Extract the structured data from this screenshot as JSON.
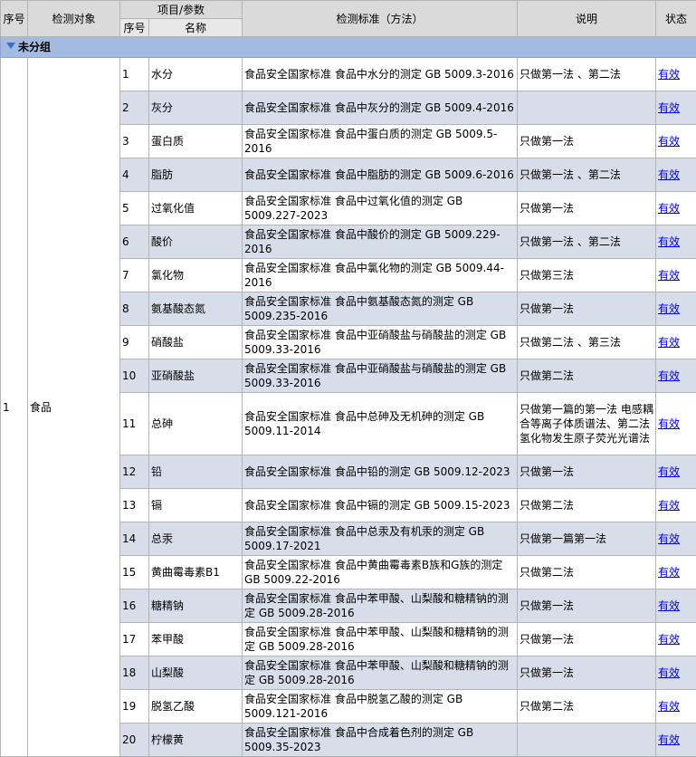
{
  "headers": {
    "seq": "序号",
    "object": "检测对象",
    "item_group": "项目/参数",
    "item_seq": "序号",
    "item_name": "名称",
    "standard": "检测标准（方法）",
    "note": "说明",
    "status": "状态"
  },
  "group": {
    "label": "未分组"
  },
  "object_row": {
    "seq": "1",
    "name": "食品"
  },
  "items": [
    {
      "no": "1",
      "name": "水分",
      "standard": "食品安全国家标准 食品中水分的测定 GB 5009.3-2016",
      "note": "只做第一法 、第二法",
      "status": "有效"
    },
    {
      "no": "2",
      "name": "灰分",
      "standard": "食品安全国家标准 食品中灰分的测定 GB 5009.4-2016",
      "note": "",
      "status": "有效"
    },
    {
      "no": "3",
      "name": "蛋白质",
      "standard": "食品安全国家标准 食品中蛋白质的测定 GB 5009.5-2016",
      "note": "只做第一法",
      "status": "有效"
    },
    {
      "no": "4",
      "name": "脂肪",
      "standard": "食品安全国家标准 食品中脂肪的测定 GB 5009.6-2016",
      "note": "只做第一法 、第二法",
      "status": "有效"
    },
    {
      "no": "5",
      "name": "过氧化值",
      "standard": "食品安全国家标准 食品中过氧化值的测定 GB 5009.227-2023",
      "note": "只做第一法",
      "status": "有效"
    },
    {
      "no": "6",
      "name": "酸价",
      "standard": "食品安全国家标准 食品中酸价的测定 GB 5009.229-2016",
      "note": "只做第一法 、第二法",
      "status": "有效"
    },
    {
      "no": "7",
      "name": "氯化物",
      "standard": "食品安全国家标准 食品中氯化物的测定 GB 5009.44-2016",
      "note": "只做第三法",
      "status": "有效"
    },
    {
      "no": "8",
      "name": "氨基酸态氮",
      "standard": "食品安全国家标准 食品中氨基酸态氮的测定 GB 5009.235-2016",
      "note": "只做第一法",
      "status": "有效"
    },
    {
      "no": "9",
      "name": "硝酸盐",
      "standard": "食品安全国家标准 食品中亚硝酸盐与硝酸盐的测定 GB 5009.33-2016",
      "note": "只做第二法 、第三法",
      "status": "有效"
    },
    {
      "no": "10",
      "name": "亚硝酸盐",
      "standard": "食品安全国家标准 食品中亚硝酸盐与硝酸盐的测定 GB 5009.33-2016",
      "note": "只做第二法",
      "status": "有效"
    },
    {
      "no": "11",
      "name": "总砷",
      "standard": "食品安全国家标准 食品中总砷及无机砷的测定 GB 5009.11-2014",
      "note": "只做第一篇的第一法 电感耦合等离子体质谱法、第二法 氢化物发生原子荧光光谱法",
      "status": "有效",
      "tall": true
    },
    {
      "no": "12",
      "name": "铅",
      "standard": "食品安全国家标准 食品中铅的测定 GB 5009.12-2023",
      "note": "只做第一法",
      "status": "有效"
    },
    {
      "no": "13",
      "name": "镉",
      "standard": "食品安全国家标准 食品中镉的测定 GB 5009.15-2023",
      "note": "只做第二法",
      "status": "有效"
    },
    {
      "no": "14",
      "name": "总汞",
      "standard": "食品安全国家标准 食品中总汞及有机汞的测定 GB 5009.17-2021",
      "note": "只做第一篇第一法",
      "status": "有效"
    },
    {
      "no": "15",
      "name": "黄曲霉毒素B1",
      "standard": "食品安全国家标准 食品中黄曲霉毒素B族和G族的测定 GB 5009.22-2016",
      "note": "只做第二法",
      "status": "有效"
    },
    {
      "no": "16",
      "name": "糖精钠",
      "standard": "食品安全国家标准 食品中苯甲酸、山梨酸和糖精钠的测定 GB 5009.28-2016",
      "note": "只做第一法",
      "status": "有效"
    },
    {
      "no": "17",
      "name": "苯甲酸",
      "standard": "食品安全国家标准 食品中苯甲酸、山梨酸和糖精钠的测定 GB 5009.28-2016",
      "note": "只做第一法",
      "status": "有效"
    },
    {
      "no": "18",
      "name": "山梨酸",
      "standard": "食品安全国家标准 食品中苯甲酸、山梨酸和糖精钠的测定 GB 5009.28-2016",
      "note": "只做第一法",
      "status": "有效"
    },
    {
      "no": "19",
      "name": "脱氢乙酸",
      "standard": "食品安全国家标准 食品中脱氢乙酸的测定 GB 5009.121-2016",
      "note": "只做第二法",
      "status": "有效"
    },
    {
      "no": "20",
      "name": "柠檬黄",
      "standard": "食品安全国家标准 食品中合成着色剂的测定 GB 5009.35-2023",
      "note": "",
      "status": "有效"
    }
  ]
}
